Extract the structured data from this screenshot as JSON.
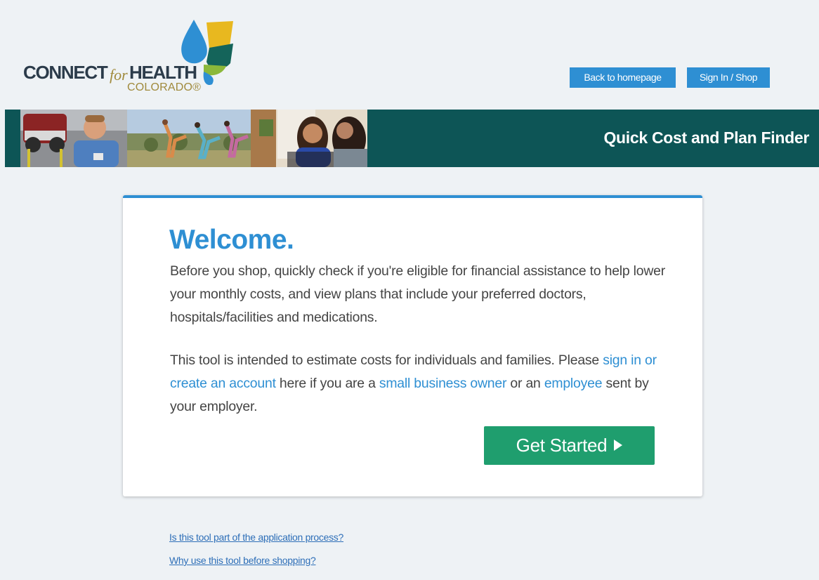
{
  "header": {
    "logo": {
      "connect": "CONNECT",
      "for": "for",
      "health": "HEALTH",
      "colorado": "COLORADO®"
    },
    "back_to_homepage": "Back to homepage",
    "sign_in_shop": "Sign In / Shop"
  },
  "banner": {
    "title": "Quick Cost and Plan Finder"
  },
  "card": {
    "heading": "Welcome.",
    "paragraph1": "Before you shop, quickly check if you're eligible for financial assistance to help lower your monthly costs, and view plans that include your preferred doctors, hospitals/facilities and medications.",
    "paragraph2": {
      "text1": "This tool is intended to estimate costs for individuals and families. Please ",
      "link_signin": "sign in or create an account",
      "text2": " here if you are a ",
      "link_small_business": "small business owner",
      "text3": " or an ",
      "link_employee": "employee",
      "text4": " sent by your employer."
    },
    "get_started": "Get Started"
  },
  "footer_links": {
    "application_process": "Is this tool part of the application process?",
    "why_use": "Why use this tool before shopping?"
  },
  "colors": {
    "accent_blue": "#2e8fd3",
    "banner_teal": "#0d5556",
    "cta_green": "#1f9e6e",
    "background": "#eef2f5"
  }
}
